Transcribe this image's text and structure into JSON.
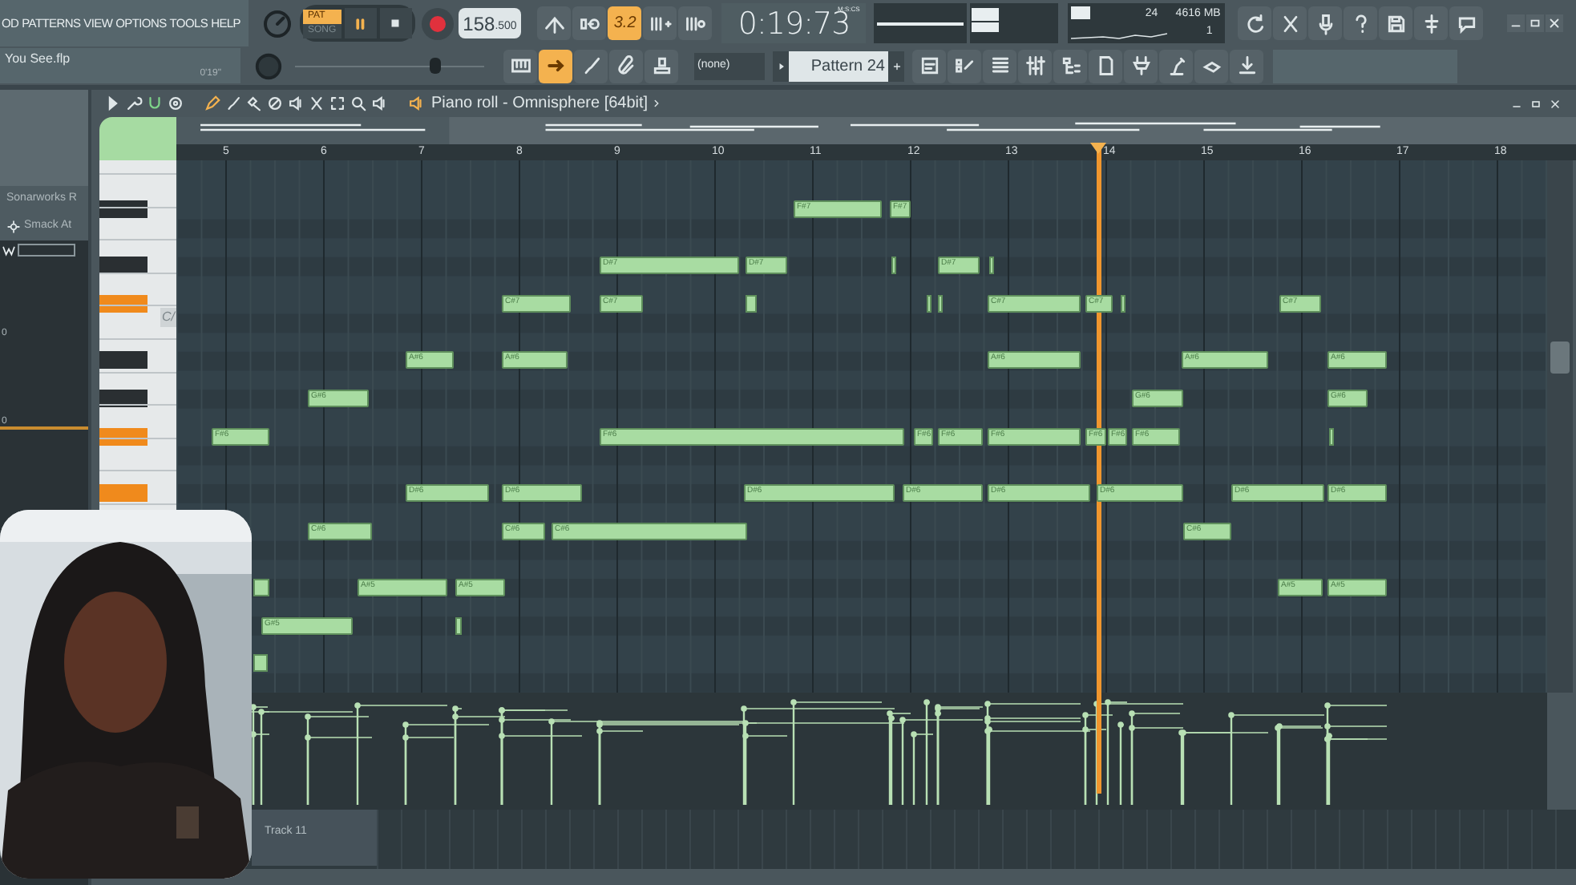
{
  "menu": [
    "OD",
    "PATTERNS",
    "VIEW",
    "OPTIONS",
    "TOOLS",
    "HELP"
  ],
  "transport_modes": [
    {
      "label": "PAT",
      "selected": true
    },
    {
      "label": "SONG",
      "selected": false
    }
  ],
  "tempo": "158",
  "tempo_fraction": ".500",
  "main_toolbar": [
    {
      "on": false
    },
    {
      "on": false
    },
    {
      "label": "3.2",
      "on": true
    },
    {
      "on": false
    },
    {
      "on": false
    }
  ],
  "time": "0:19:73",
  "time_unit": "M:S:CS",
  "cpu": {
    "voices": "24",
    "memory": "4616 MB",
    "polyphony": "1"
  },
  "project": {
    "file": "You See.flp",
    "length": "0'19\""
  },
  "master_pitch": {
    "level": 0.76
  },
  "tool_buttons": [
    {
      "on": false
    },
    {
      "on": true
    },
    {
      "on": false
    },
    {
      "on": false
    },
    {
      "on": false
    }
  ],
  "pattern_filter": "(none)",
  "pattern": "Pattern 24",
  "browser": {
    "items": [
      "Sonarworks R",
      "Smack At"
    ],
    "scale": [
      "0",
      "0"
    ]
  },
  "piano_roll": {
    "title": "Piano roll - Omnisphere [64bit]",
    "bars": [
      "5",
      "6",
      "7",
      "8",
      "9",
      "10",
      "11",
      "12",
      "13",
      "14",
      "15",
      "16",
      "17",
      "18"
    ],
    "key_label": "C/",
    "black_keys": [
      {
        "pressed": false
      },
      {
        "pressed": false
      },
      {
        "pressed": true
      },
      {
        "pressed": false
      },
      {
        "pressed": false
      },
      {
        "pressed": true
      },
      {
        "pressed": true
      }
    ],
    "notes": [
      "F#7",
      "F#7",
      "D#7",
      "D#7",
      "D#7",
      "C#7",
      "C#7",
      "C#7",
      "C#7",
      "C#7",
      "A#6",
      "A#6",
      "A#6",
      "A#6",
      "A#6",
      "G#6",
      "G#6",
      "G#6",
      "F#6",
      "F#6",
      "F#6",
      "F#6",
      "F#6",
      "F#6",
      "F#6",
      "F#6",
      "D#6",
      "D#6",
      "D#6",
      "D#6",
      "D#6",
      "D#6",
      "D#6",
      "D#6",
      "C#6",
      "C#6",
      "C#6",
      "C#6",
      "A#5",
      "A#5",
      "A#5",
      "A#5",
      "G#5"
    ],
    "track": "Track 11"
  },
  "webcam": {
    "kind": "picture"
  }
}
